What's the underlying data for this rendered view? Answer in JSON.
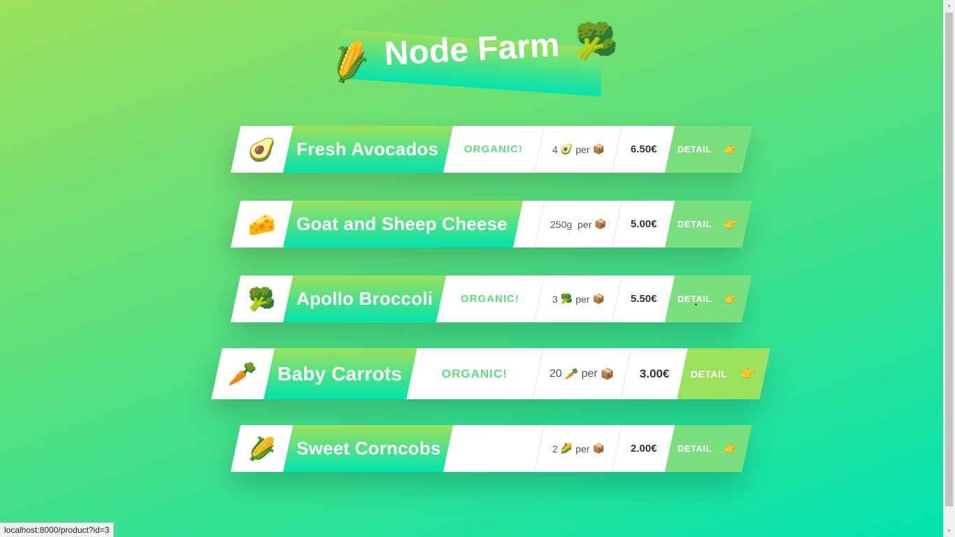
{
  "header": {
    "title": "Node Farm"
  },
  "products": [
    {
      "emoji": "🥑",
      "name": "Fresh Avocados",
      "organic": "ORGANIC!",
      "qty_num": "4",
      "qty_emoji": "🥑",
      "qty_per": "per",
      "box_emoji": "📦",
      "price": "6.50€",
      "detail": "DETAIL"
    },
    {
      "emoji": "🧀",
      "name": "Goat and Sheep Cheese",
      "organic": "",
      "qty_num": "250g",
      "qty_emoji": "",
      "qty_per": "per",
      "box_emoji": "📦",
      "price": "5.00€",
      "detail": "DETAIL"
    },
    {
      "emoji": "🥦",
      "name": "Apollo Broccoli",
      "organic": "ORGANIC!",
      "qty_num": "3",
      "qty_emoji": "🥦",
      "qty_per": "per",
      "box_emoji": "📦",
      "price": "5.50€",
      "detail": "DETAIL"
    },
    {
      "emoji": "🥕",
      "name": "Baby Carrots",
      "organic": "ORGANIC!",
      "qty_num": "20",
      "qty_emoji": "🥕",
      "qty_per": "per",
      "box_emoji": "📦",
      "price": "3.00€",
      "detail": "DETAIL"
    },
    {
      "emoji": "🌽",
      "name": "Sweet Corncobs",
      "organic": "",
      "qty_num": "2",
      "qty_emoji": "🌽",
      "qty_per": "per",
      "box_emoji": "📦",
      "price": "2.00€",
      "detail": "DETAIL"
    }
  ],
  "header_emoji_left": "🌽",
  "header_emoji_right": "🥦",
  "detail_icon": "👉",
  "status_url": "localhost:8000/product?id=3"
}
